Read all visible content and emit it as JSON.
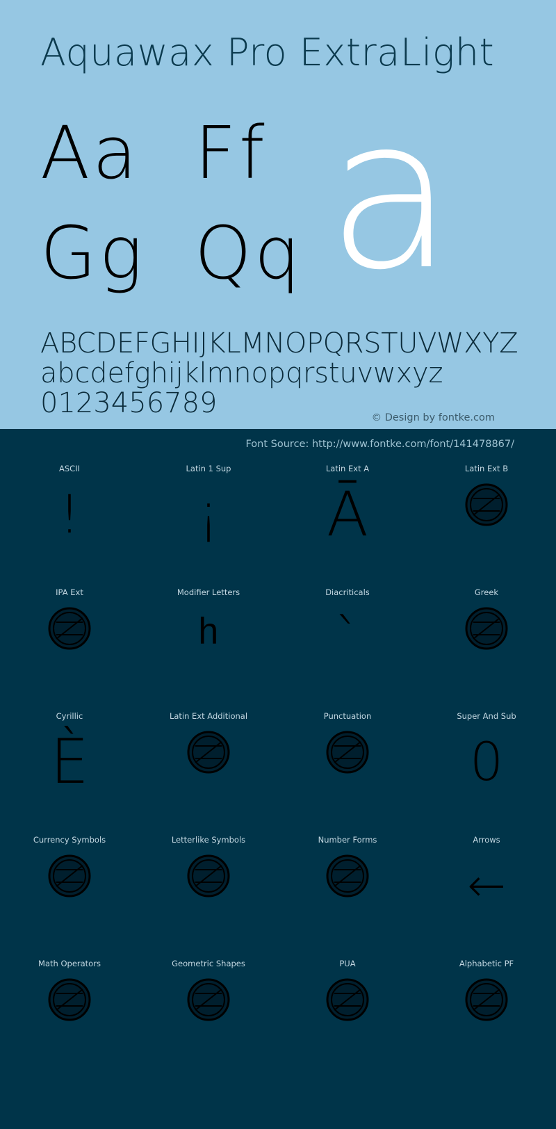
{
  "specimen": {
    "title": "Aquawax Pro ExtraLight",
    "samples": [
      {
        "name": "Aa",
        "text": "Aa"
      },
      {
        "name": "Ff",
        "text": "Ff"
      },
      {
        "name": "Gg",
        "text": "Gg"
      },
      {
        "name": "Qq",
        "text": "Qq"
      }
    ],
    "feature_glyph": "a",
    "uppercase": "ABCDEFGHIJKLMNOPQRSTUVWXYZ",
    "lowercase": "abcdefghijklmnopqrstuvwxyz",
    "digits": "0123456789",
    "copyright": "© Design by fontke.com",
    "background_color": "#96c7e3",
    "text_color": "#0b3a4e",
    "feature_glyph_color": "#ffffff"
  },
  "blocks_section": {
    "font_source": "Font Source: http://www.fontke.com/font/141478867/",
    "background_color": "#003449",
    "label_color": "#c3d8e2",
    "rows": [
      [
        {
          "label": "ASCII",
          "glyph": "!",
          "supported": true
        },
        {
          "label": "Latin 1 Sup",
          "glyph": "¡",
          "supported": true
        },
        {
          "label": "Latin Ext A",
          "glyph": "Ā",
          "supported": true
        },
        {
          "label": "Latin Ext B",
          "glyph": "",
          "supported": false
        }
      ],
      [
        {
          "label": "IPA Ext",
          "glyph": "",
          "supported": false
        },
        {
          "label": "Modifier Letters",
          "glyph": "ʰ",
          "supported": true
        },
        {
          "label": "Diacriticals",
          "glyph": "`",
          "supported": true
        },
        {
          "label": "Greek",
          "glyph": "",
          "supported": false
        }
      ],
      [
        {
          "label": "Cyrillic",
          "glyph": "È",
          "supported": true
        },
        {
          "label": "Latin Ext Additional",
          "glyph": "",
          "supported": false
        },
        {
          "label": "Punctuation",
          "glyph": "",
          "supported": false
        },
        {
          "label": "Super And Sub",
          "glyph": "0",
          "supported": true
        }
      ],
      [
        {
          "label": "Currency Symbols",
          "glyph": "",
          "supported": false
        },
        {
          "label": "Letterlike Symbols",
          "glyph": "",
          "supported": false
        },
        {
          "label": "Number Forms",
          "glyph": "",
          "supported": false
        },
        {
          "label": "Arrows",
          "glyph": "←",
          "supported": true
        }
      ],
      [
        {
          "label": "Math Operators",
          "glyph": "",
          "supported": false
        },
        {
          "label": "Geometric Shapes",
          "glyph": "",
          "supported": false
        },
        {
          "label": "PUA",
          "glyph": "",
          "supported": false
        },
        {
          "label": "Alphabetic PF",
          "glyph": "",
          "supported": false
        }
      ]
    ]
  }
}
